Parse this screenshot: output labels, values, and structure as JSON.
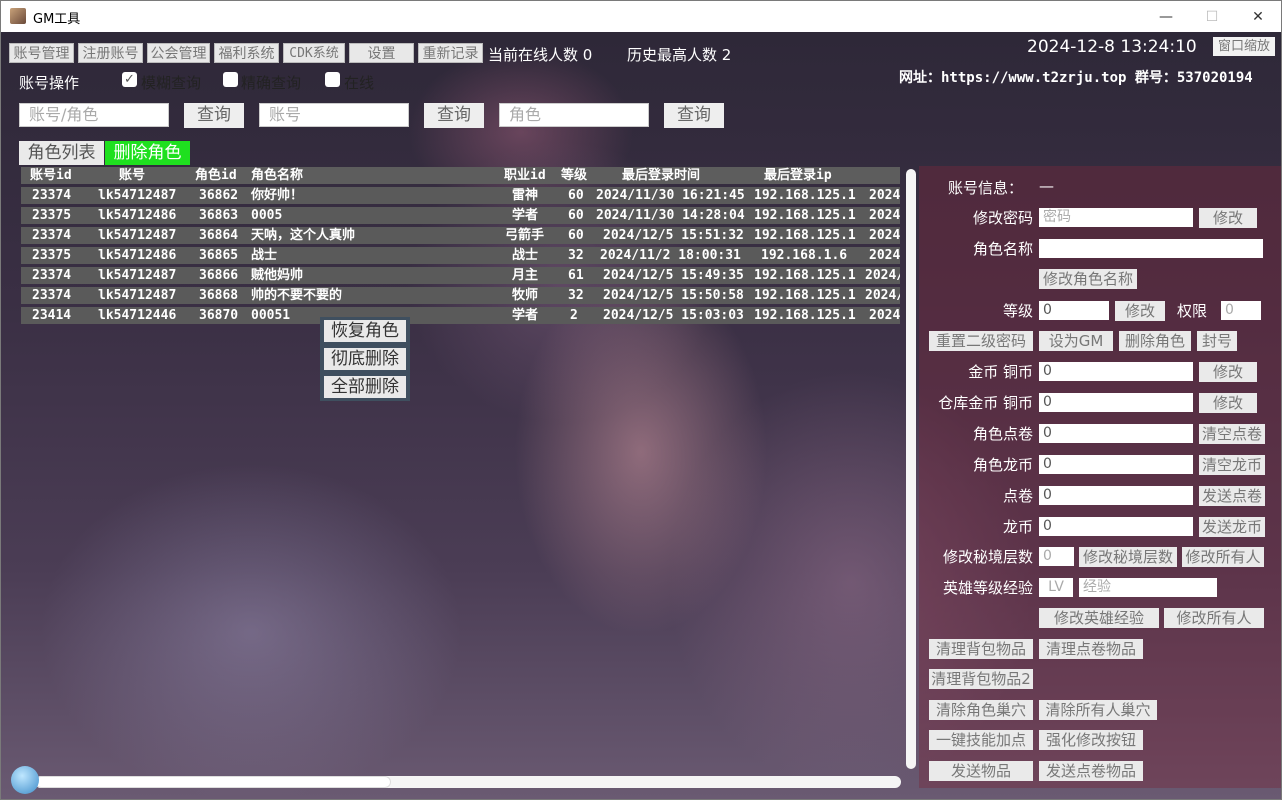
{
  "window": {
    "title": "GM工具",
    "minimize": "—",
    "maximize": "☐",
    "close": "✕"
  },
  "tabs": [
    "账号管理",
    "注册账号",
    "公会管理",
    "福利系统",
    "CDK系统",
    "设置",
    "重新记录"
  ],
  "stats": {
    "online": "当前在线人数 0",
    "peak": "历史最高人数 2"
  },
  "clock": "2024-12-8 13:24:10",
  "zoom_button": "窗口缩放",
  "site_info": "网址：https://www.t2zrju.top 群号：537020194",
  "account_ops": {
    "label": "账号操作",
    "fuzzy": "模糊查询",
    "exact": "精确查询",
    "online": "在线"
  },
  "search": {
    "ph1": "账号/角色",
    "ph2": "账号",
    "ph3": "角色",
    "btn": "查询"
  },
  "subtabs": {
    "list": "角色列表",
    "delete": "删除角色"
  },
  "table": {
    "headers": [
      "账号id",
      "账号",
      "角色id",
      "角色名称",
      "职业id",
      "等级",
      "最后登录时间",
      "最后登录ip"
    ],
    "rows": [
      [
        "23374",
        "lk54712487",
        "36862",
        "你好帅！",
        "雷神",
        "60",
        "2024/11/30 16:21:45",
        "192.168.125.1",
        "2024"
      ],
      [
        "23375",
        "lk54712486",
        "36863",
        "0005",
        "学者",
        "60",
        "2024/11/30 14:28:04",
        "192.168.125.1",
        "2024"
      ],
      [
        "23374",
        "lk54712487",
        "36864",
        "天呐，这个人真帅",
        "弓箭手",
        "60",
        "2024/12/5 15:51:32",
        "192.168.125.1",
        "2024"
      ],
      [
        "23375",
        "lk54712486",
        "36865",
        "战士",
        "战士",
        "32",
        "2024/11/2 18:00:31",
        "192.168.1.6",
        "2024"
      ],
      [
        "23374",
        "lk54712487",
        "36866",
        "贼他妈帅",
        "月主",
        "61",
        "2024/12/5 15:49:35",
        "192.168.125.1",
        "2024/"
      ],
      [
        "23374",
        "lk54712487",
        "36868",
        "帅的不要不要的",
        "牧师",
        "32",
        "2024/12/5 15:50:58",
        "192.168.125.1",
        "2024/"
      ],
      [
        "23414",
        "lk54712446",
        "36870",
        "00051",
        "学者",
        "2",
        "2024/12/5 15:03:03",
        "192.168.125.1",
        "2024"
      ]
    ]
  },
  "context_menu": [
    "恢复角色",
    "彻底删除",
    "全部删除"
  ],
  "right": {
    "account_info_label": "账号信息：",
    "account_info_value": "—",
    "change_pwd_label": "修改密码",
    "pwd_placeholder": "密码",
    "modify": "修改",
    "role_name_label": "角色名称",
    "change_role_name": "修改角色名称",
    "level_label": "等级",
    "level_value": "0",
    "perm_label": "权限",
    "perm_value": "0",
    "reset_pwd2": "重置二级密码",
    "set_gm": "设为GM",
    "del_role": "删除角色",
    "ban": "封号",
    "gold_label": "金币 铜币",
    "gold_value": "0",
    "wh_gold_label": "仓库金币 铜币",
    "wh_gold_value": "0",
    "points_label": "角色点卷",
    "points_value": "0",
    "clear_points": "清空点卷",
    "dragon_label": "角色龙币",
    "dragon_value": "0",
    "clear_dragon": "清空龙币",
    "dj_label": "点卷",
    "dj_value": "0",
    "send_dj": "发送点卷",
    "lb_label": "龙币",
    "lb_value": "0",
    "send_lb": "发送龙币",
    "secret_label": "修改秘境层数",
    "secret_value": "0",
    "change_secret": "修改秘境层数",
    "change_all": "修改所有人",
    "hero_label": "英雄等级经验",
    "lv_ph": "LV",
    "exp_ph": "经验",
    "change_hero": "修改英雄经验",
    "change_all2": "修改所有人",
    "clear_bag": "清理背包物品",
    "clear_dj_items": "清理点卷物品",
    "clear_bag2": "清理背包物品2",
    "clear_role_nest": "清除角色巢穴",
    "clear_all_nest": "清除所有人巢穴",
    "skill_points": "一键技能加点",
    "enhance": "强化修改按钮",
    "send_item": "发送物品",
    "send_dj_item": "发送点卷物品"
  }
}
